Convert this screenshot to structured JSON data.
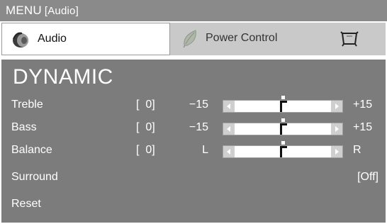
{
  "header": {
    "menu": "MENU",
    "section": "[Audio]"
  },
  "tabs": [
    {
      "label": "Audio",
      "icon": "speaker-icon",
      "active": true
    },
    {
      "label": "Power Control",
      "icon": "leaf-icon",
      "active": false
    },
    {
      "label": "",
      "icon": "setup-icon",
      "active": false
    }
  ],
  "panel": {
    "title": "DYNAMIC",
    "rows": [
      {
        "label": "Treble",
        "value": "[  0]",
        "min": "−15",
        "max": "+15",
        "level": 0.5
      },
      {
        "label": "Bass",
        "value": "[  0]",
        "min": "−15",
        "max": "+15",
        "level": 0.5
      },
      {
        "label": "Balance",
        "value": "[  0]",
        "min": "L",
        "max": "R",
        "level": 0.5
      },
      {
        "label": "Surround",
        "value": "[Off]"
      },
      {
        "label": "Reset"
      }
    ]
  },
  "colors": {
    "header_bg": "#8a8a8a",
    "panel_bg": "#7c7c7c",
    "tab_row_bg": "#c9c9c9",
    "text_light": "#ffffff"
  }
}
